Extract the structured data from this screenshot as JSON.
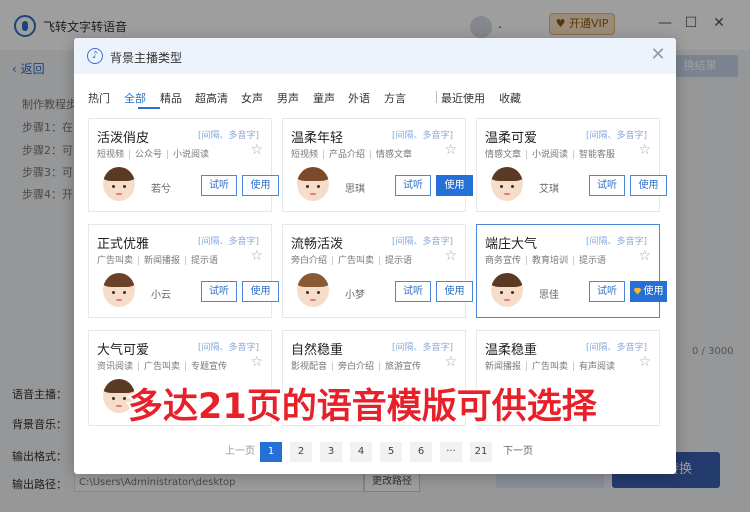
{
  "app": {
    "title": "飞转文字转语音",
    "user_label": ".",
    "vip_label": "开通VIP",
    "back_label": "返回",
    "result_label": "换结果",
    "steps": [
      "制作教程步",
      "步骤1：在",
      "步骤2：可",
      "步骤3：可",
      "步骤4：开"
    ],
    "char_counter": "0 / 3000",
    "voice_label": "语音主播：",
    "music_label": "背景音乐：",
    "format_label": "输出格式：",
    "path_label": "输出路径：",
    "path_value": "C:\\Users\\Administrator\\desktop",
    "path_button": "更改路径",
    "convert_label": "开始转换"
  },
  "modal": {
    "title": "背景主播类型",
    "tabs": [
      "热门",
      "全部",
      "精品",
      "超高清",
      "女声",
      "男声",
      "童声",
      "外语",
      "方言",
      "最近使用",
      "收藏"
    ],
    "active_tab": "全部",
    "cards": [
      {
        "title": "活泼俏皮",
        "meta": "[间隔、多音字]",
        "tags": [
          "短视频",
          "公众号",
          "小说阅读"
        ],
        "name": "若兮",
        "try": "试听",
        "use": "使用"
      },
      {
        "title": "温柔年轻",
        "meta": "[间隔、多音字]",
        "tags": [
          "短视频",
          "产品介绍",
          "情感文章"
        ],
        "name": "思琪",
        "try": "试听",
        "use": "使用"
      },
      {
        "title": "温柔可爱",
        "meta": "[间隔、多音字]",
        "tags": [
          "情感文章",
          "小说阅读",
          "智能客服"
        ],
        "name": "艾琪",
        "try": "试听",
        "use": "使用"
      },
      {
        "title": "正式优雅",
        "meta": "[间隔、多音字]",
        "tags": [
          "广告叫卖",
          "新闻播报",
          "提示语"
        ],
        "name": "小云",
        "try": "试听",
        "use": "使用"
      },
      {
        "title": "流畅活泼",
        "meta": "[间隔、多音字]",
        "tags": [
          "旁白介绍",
          "广告叫卖",
          "提示语"
        ],
        "name": "小梦",
        "try": "试听",
        "use": "使用"
      },
      {
        "title": "端庄大气",
        "meta": "[间隔、多音字]",
        "tags": [
          "商务宣传",
          "教育培训",
          "提示语"
        ],
        "name": "思佳",
        "try": "试听",
        "use": "使用"
      },
      {
        "title": "大气可爱",
        "meta": "[间隔、多音字]",
        "tags": [
          "资讯阅读",
          "广告叫卖",
          "专题宣传"
        ]
      },
      {
        "title": "自然稳重",
        "meta": "[间隔、多音字]",
        "tags": [
          "影视配音",
          "旁白介绍",
          "旅游宣传"
        ]
      },
      {
        "title": "温柔稳重",
        "meta": "[间隔、多音字]",
        "tags": [
          "新闻播报",
          "广告叫卖",
          "有声阅读"
        ]
      }
    ],
    "pagination": {
      "prev": "上一页",
      "pages": [
        "1",
        "2",
        "3",
        "4",
        "5",
        "6",
        "···",
        "21"
      ],
      "current": "1",
      "next": "下一页"
    }
  },
  "promo_text": "多达21页的语音模版可供选择",
  "colors": {
    "accent": "#2470d6",
    "promo": "#e8202a",
    "vip": "#f8e2c4"
  }
}
